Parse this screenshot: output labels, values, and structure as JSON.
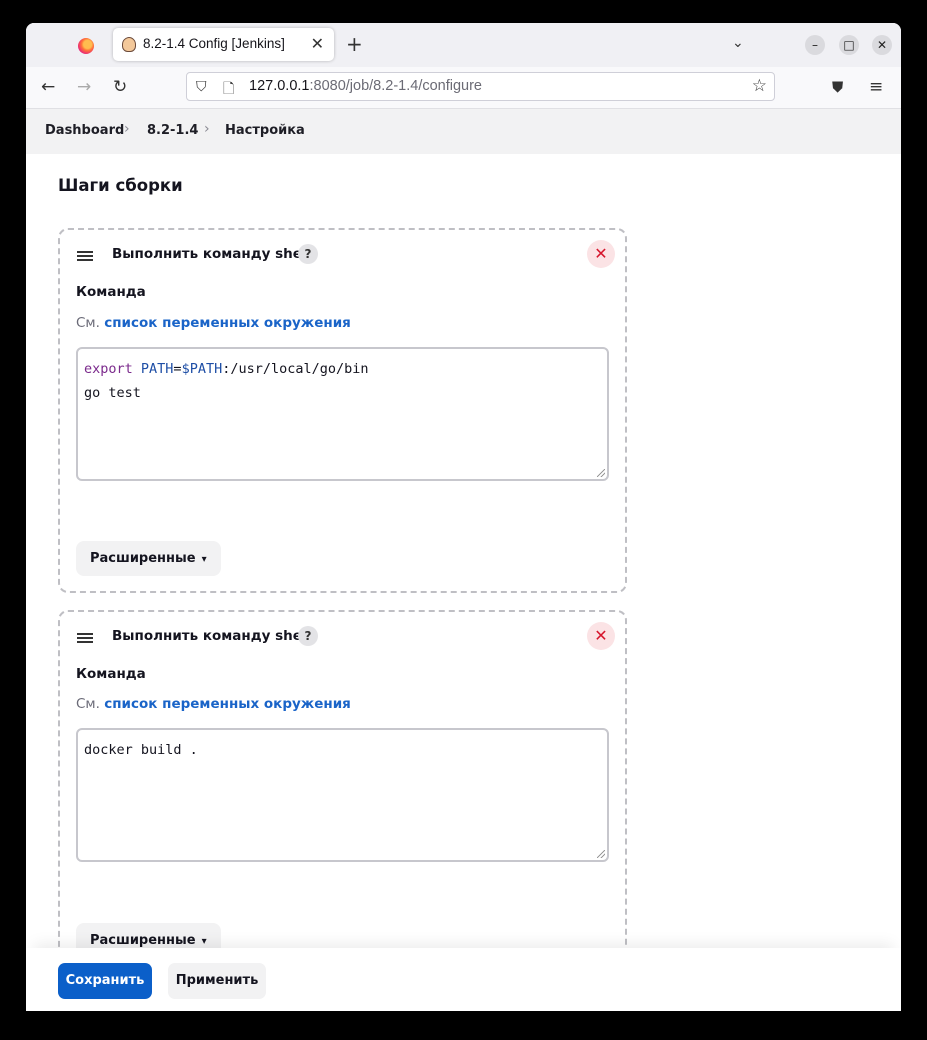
{
  "browser": {
    "tab_title": "8.2-1.4 Config [Jenkins]",
    "url_host": "127.0.0.1",
    "url_path": ":8080/job/8.2-1.4/configure"
  },
  "breadcrumb": [
    "Dashboard",
    "8.2-1.4",
    "Настройка"
  ],
  "section_title": "Шаги сборки",
  "steps": [
    {
      "title": "Выполнить команду shell",
      "help": "?",
      "field_label": "Команда",
      "env_prefix": "См.",
      "env_link": "список переменных окружения",
      "code_lines": [
        {
          "kw": "export",
          "name": " PATH",
          "eq": "=",
          "var": "$PATH",
          "rest": ":/usr/local/go/bin"
        },
        {
          "text": "go test"
        }
      ],
      "advanced_label": "Расширенные"
    },
    {
      "title": "Выполнить команду shell",
      "help": "?",
      "field_label": "Команда",
      "env_prefix": "См.",
      "env_link": "список переменных окружения",
      "code_lines": [
        {
          "text": "docker build ."
        }
      ],
      "advanced_label": "Расширенные"
    }
  ],
  "footer": {
    "save_label": "Сохранить",
    "apply_label": "Применить"
  },
  "colors": {
    "save_button": "#0b5fc9",
    "link": "#1a64c8",
    "delete_icon": "#d6152c",
    "keyword": "#7b2a8c",
    "variable": "#1f4fa6"
  }
}
